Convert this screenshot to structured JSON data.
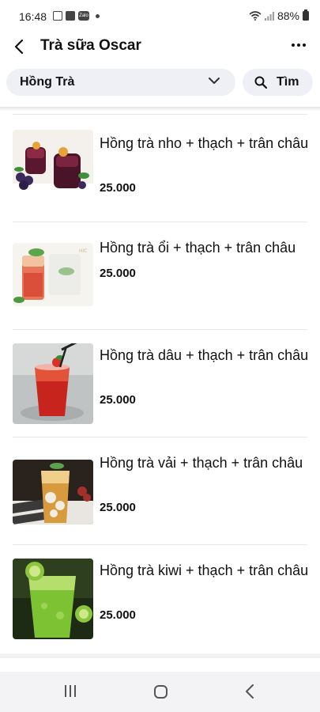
{
  "status_bar": {
    "time": "16:48",
    "battery": "88%",
    "notification_icons": [
      "image-icon",
      "bag-icon",
      "zalo-icon",
      "dot-icon"
    ],
    "zalo_text": "Zalo"
  },
  "header": {
    "title": "Trà sữa Oscar"
  },
  "filter": {
    "category": "Hồng Trà",
    "search_label": "Tìm"
  },
  "products": [
    {
      "name": "Hồng trà nho + thạch + trân châu",
      "price": "25.000",
      "image": "grape-tea-photo"
    },
    {
      "name": "Hồng trà ổi + thạch + trân châu",
      "price": "25.000",
      "image": "guava-tea-photo"
    },
    {
      "name": "Hồng trà dâu + thạch + trân châu",
      "price": "25.000",
      "image": "strawberry-tea-photo"
    },
    {
      "name": "Hồng trà vải + thạch + trân châu",
      "price": "25.000",
      "image": "lychee-tea-photo"
    },
    {
      "name": "Hồng trà kiwi + thạch + trân châu",
      "price": "25.000",
      "image": "kiwi-tea-photo"
    }
  ],
  "colors": {
    "pill_background": "#eef0f6",
    "divider": "#e6e6e6",
    "nav_background": "#f3f3f6"
  }
}
